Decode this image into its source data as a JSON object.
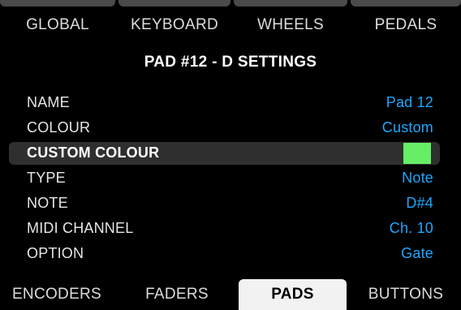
{
  "top_tabs": [
    {
      "label": "GLOBAL"
    },
    {
      "label": "KEYBOARD"
    },
    {
      "label": "WHEELS"
    },
    {
      "label": "PEDALS"
    }
  ],
  "title": "PAD #12 - D SETTINGS",
  "settings": [
    {
      "label": "NAME",
      "value": "Pad 12"
    },
    {
      "label": "COLOUR",
      "value": "Custom"
    },
    {
      "label": "CUSTOM COLOUR",
      "value": "",
      "swatch_color": "#66ee66",
      "selected": true
    },
    {
      "label": "TYPE",
      "value": "Note"
    },
    {
      "label": "NOTE",
      "value": "D#4"
    },
    {
      "label": "MIDI CHANNEL",
      "value": "Ch. 10"
    },
    {
      "label": "OPTION",
      "value": "Gate"
    }
  ],
  "bottom_tabs": [
    {
      "label": "ENCODERS"
    },
    {
      "label": "FADERS"
    },
    {
      "label": "PADS",
      "active": true
    },
    {
      "label": "BUTTONS"
    }
  ],
  "colors": {
    "value_text": "#1ea7ff",
    "selected_row_bg": "#2f2f2f",
    "active_tab_bg": "#f2f2f2"
  }
}
